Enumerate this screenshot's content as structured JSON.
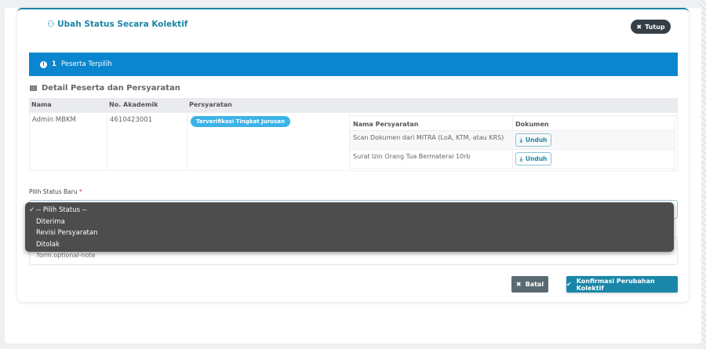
{
  "modal": {
    "title": "Ubah Status Secara Kolektif",
    "close_label": "Tutup",
    "info": {
      "count": "1",
      "text": "Peserta Terpilih"
    },
    "section_title": "Detail Peserta dan Persyaratan",
    "table": {
      "headers": [
        "Nama",
        "No. Akademik",
        "Persyaratan"
      ],
      "rows": [
        {
          "nama": "Admin MBKM",
          "no_akademik": "4610423001",
          "status_badge": "Terverifikasi Tingkat Jurusan",
          "requirements": {
            "headers": [
              "Nama Persyaratan",
              "Dokumen"
            ],
            "items": [
              {
                "name": "Scan Dokumen dari MITRA (LoA, KTM, atau KRS)",
                "button": "Unduh"
              },
              {
                "name": "Surat Izin Orang Tua Bermaterai 10rb",
                "button": "Unduh"
              }
            ]
          }
        }
      ]
    },
    "form": {
      "status_label": "Pilih Status Baru",
      "required_mark": "*",
      "options": [
        "-- Pilih Status --",
        "Diterima",
        "Revisi Persyaratan",
        "Ditolak"
      ],
      "selected": "-- Pilih Status --",
      "note_placeholder": "form.optional-note"
    },
    "cancel_label": "Batal",
    "confirm_label": "Konfirmasi Perubahan Kolektif"
  },
  "colors": {
    "accent": "#1b86a6",
    "info": "#0a86cf",
    "badge": "#3bb3e8",
    "cancel": "#5b6a72",
    "close": "#343f47"
  }
}
